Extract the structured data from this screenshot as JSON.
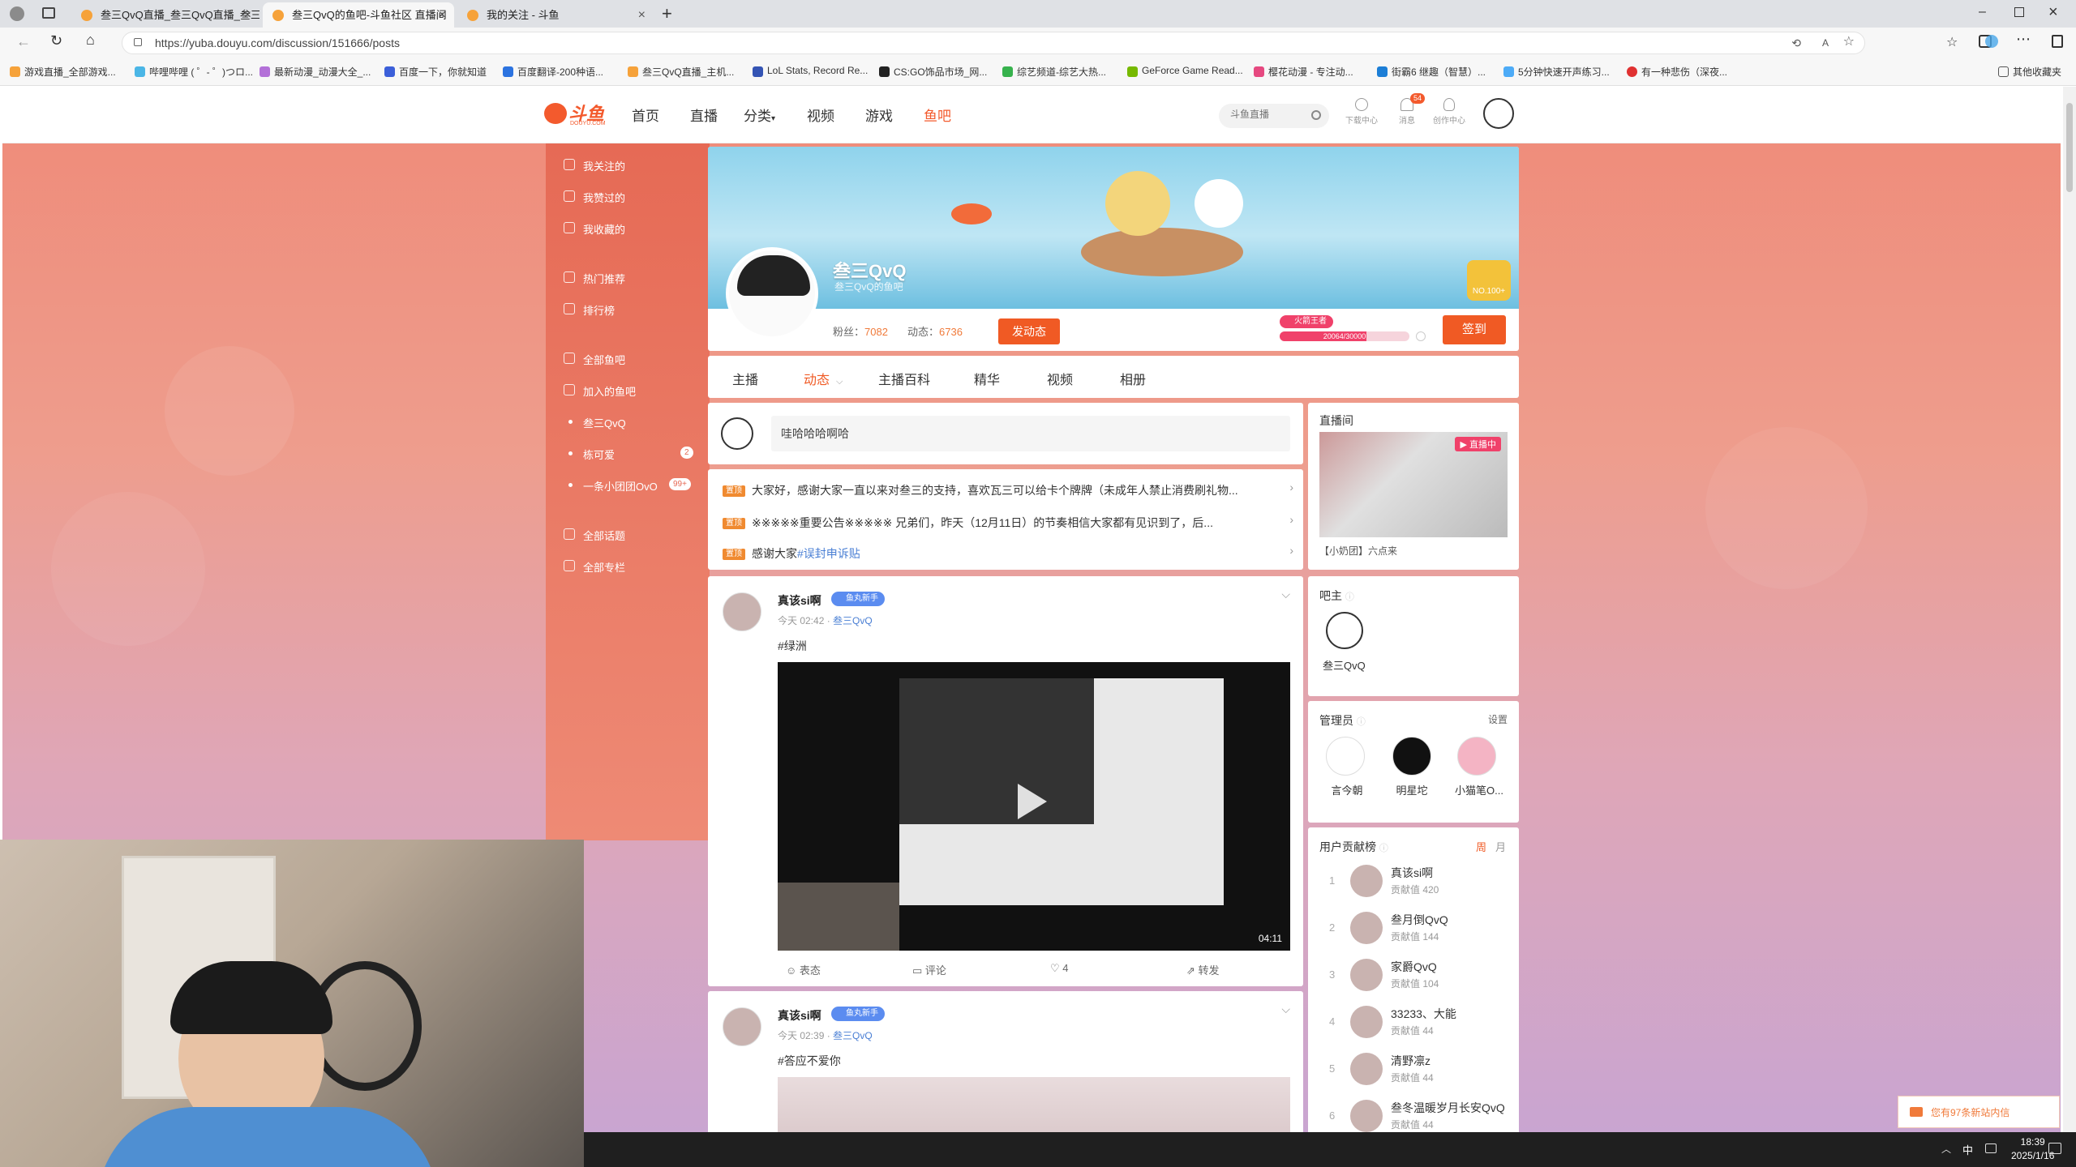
{
  "browser": {
    "tabs": [
      {
        "title": "叁三QvQ直播_叁三QvQ直播_叁三"
      },
      {
        "title": "叁三QvQ的鱼吧-斗鱼社区 直播间"
      },
      {
        "title": "我的关注 - 斗鱼"
      }
    ],
    "url": "https://yuba.douyu.com/discussion/151666/posts",
    "bookmarks": [
      "游戏直播_全部游戏...",
      "哔哩哔哩 ( ゜- ゜)つロ...",
      "最新动漫_动漫大全_...",
      "百度一下，你就知道",
      "百度翻译-200种语...",
      "叁三QvQ直播_主机...",
      "LoL Stats, Record Re...",
      "CS:GO饰品市场_网...",
      "综艺频道-综艺大热...",
      "GeForce Game Read...",
      "樱花动漫 - 专注动...",
      "街霸6 继趣（智慧）...",
      "5分钟快速开声练习...",
      "有一种悲伤（深夜..."
    ],
    "other_bookmarks": "其他收藏夹"
  },
  "site": {
    "logo": "斗鱼",
    "logo_sub": "DOUYU.COM",
    "nav": [
      "首页",
      "直播",
      "分类",
      "视频",
      "游戏",
      "鱼吧"
    ],
    "search_placeholder": "斗鱼直播",
    "tools": [
      {
        "label": "下载中心",
        "icon": "download-icon"
      },
      {
        "label": "消息",
        "icon": "bell-icon",
        "badge": "54"
      },
      {
        "label": "创作中心",
        "icon": "lightbulb-icon"
      }
    ]
  },
  "sidebar": {
    "top": [
      "我关注的",
      "我赞过的",
      "我收藏的"
    ],
    "mid": [
      "热门推荐",
      "排行榜"
    ],
    "groups_header": "全部鱼吧",
    "joined": "加入的鱼吧",
    "joined_items": [
      {
        "label": "叁三QvQ",
        "badge": ""
      },
      {
        "label": "栋可爱",
        "badge": "2"
      },
      {
        "label": "一条小团团OvO",
        "badge": "99+"
      }
    ],
    "bottom": [
      "全部话题",
      "全部专栏"
    ]
  },
  "profile": {
    "name": "叁三QvQ",
    "subtitle": "叁三QvQ的鱼吧",
    "fans_label": "粉丝：",
    "fans": "7082",
    "posts_label": "动态：",
    "posts": "6736",
    "post_button": "发动态",
    "rank_badge": "NO.100+",
    "level_tag": "火箭王者",
    "progress_text": "20064/30000",
    "progress_fraction": 0.67,
    "signin_button": "签到"
  },
  "tabs": [
    "主播",
    "动态",
    "主播百科",
    "精华",
    "视频",
    "相册"
  ],
  "composer": {
    "placeholder": "哇哈哈哈啊哈"
  },
  "announcements": [
    {
      "tag": "置顶",
      "text": "大家好，感谢大家一直以来对叁三的支持，喜欢瓦三可以给卡个牌牌（未成年人禁止消费刷礼物..."
    },
    {
      "tag": "置顶",
      "text": "※※※※※重要公告※※※※※ 兄弟们，昨天（12月11日）的节奏相信大家都有见识到了，后..."
    },
    {
      "tag": "置顶",
      "text": "感谢大家",
      "link": "#误封申诉贴"
    }
  ],
  "posts": [
    {
      "author": "真该si啊",
      "tag": "鱼丸新手",
      "time": "今天 02:42",
      "group": "叁三QvQ",
      "topic": "#绿洲",
      "duration": "04:11",
      "actions": [
        "表态",
        "评论",
        "4",
        "转发"
      ]
    },
    {
      "author": "真该si啊",
      "tag": "鱼丸新手",
      "time": "今天 02:39",
      "group": "叁三QvQ",
      "topic": "#答应不爱你"
    }
  ],
  "right": {
    "live_title": "直播间",
    "live_badge": "直播中",
    "live_caption": "【小奶团】六点来",
    "owner_title": "吧主",
    "owner_name": "叁三QvQ",
    "admins_title": "管理员",
    "admins_settings": "设置",
    "admins": [
      "言今朝",
      "明星坨",
      "小猫笔O..."
    ],
    "rank_title": "用户贡献榜",
    "rank_tabs": [
      "周",
      "月"
    ],
    "rank": [
      {
        "no": "1",
        "name": "真该si啊",
        "score": "贡献值 420"
      },
      {
        "no": "2",
        "name": "叁月倒QvQ",
        "score": "贡献值 144"
      },
      {
        "no": "3",
        "name": "家爵QvQ",
        "score": "贡献值 104"
      },
      {
        "no": "4",
        "name": "33233、大能",
        "score": "贡献值 44"
      },
      {
        "no": "5",
        "name": "清野凛z",
        "score": "贡献值 44"
      },
      {
        "no": "6",
        "name": "叁冬温暖岁月长安QvQ",
        "score": "贡献值 44"
      }
    ]
  },
  "notification": "您有97条新站内信",
  "taskbar": {
    "ime": "中",
    "time": "18:39",
    "date": "2025/1/16"
  },
  "colors": {
    "brand": "#f35a2d",
    "accent_orange": "#f07a3a",
    "link": "#4a7fd4"
  }
}
